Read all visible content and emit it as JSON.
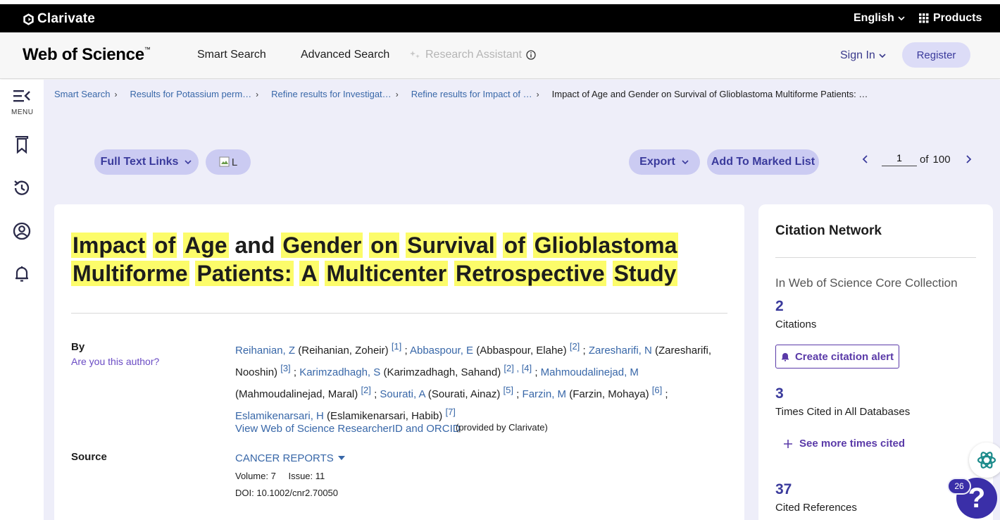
{
  "topbar": {
    "brand": "Clarivate",
    "language": "English",
    "products": "Products"
  },
  "header": {
    "logo": "Web of Science",
    "logo_tm": "™",
    "nav": [
      "Smart Search",
      "Advanced Search",
      "Research Assistant"
    ],
    "sign_in": "Sign In",
    "register": "Register"
  },
  "sidebar": {
    "menu_label": "MENU",
    "items": [
      "menu-icon",
      "marked-list-icon",
      "history-icon",
      "profile-icon",
      "alerts-icon"
    ]
  },
  "breadcrumb": [
    "Smart Search",
    "Results for Potassium perm…",
    "Refine results for Investigat…",
    "Refine results for Impact of …",
    "Impact of Age and Gender on Survival of Glioblastoma Multiforme Patients: …"
  ],
  "toolbar": {
    "full_text_links": "Full Text Links",
    "image_alt": "L",
    "export": "Export",
    "add_to_marked": "Add To Marked List",
    "page_current": "1",
    "page_of": "of",
    "page_total": "100"
  },
  "record": {
    "title_words": [
      "Impact",
      "of",
      "Age",
      "and",
      "Gender",
      "on",
      "Survival",
      "of",
      "Glioblastoma",
      "Multiforme",
      "Patients:",
      "A",
      "Multicenter",
      "Retrospective",
      "Study"
    ],
    "title_highlight": [
      true,
      true,
      true,
      false,
      true,
      true,
      true,
      true,
      true,
      true,
      true,
      true,
      true,
      true,
      true
    ],
    "by_label": "By",
    "are_you_author": "Are you this author?",
    "authors": [
      {
        "short": "Reihanian, Z",
        "full": "Reihanian, Zoheir",
        "refs": "[1]"
      },
      {
        "short": "Abbaspour, E",
        "full": "Abbaspour, Elahe",
        "refs": "[2]"
      },
      {
        "short": "Zaresharifi, N",
        "full": "Zaresharifi, Nooshin",
        "refs": "[3]"
      },
      {
        "short": "Karimzadhagh, S",
        "full": "Karimzadhagh, Sahand",
        "refs": "[2] , [4]"
      },
      {
        "short": "Mahmoudalinejad, M",
        "full": "Mahmoudalinejad, Maral",
        "refs": "[2]"
      },
      {
        "short": "Sourati, A",
        "full": "Sourati, Ainaz",
        "refs": "[5]"
      },
      {
        "short": "Farzin, M",
        "full": "Farzin, Mohaya",
        "refs": "[6]"
      },
      {
        "short": "Eslamikenarsari, H",
        "full": "Eslamikenarsari, Habib",
        "refs": "[7]"
      }
    ],
    "researcher_link": "View Web of Science ResearcherID and ORCID",
    "provided_by": "(provided by Clarivate)",
    "source_label": "Source",
    "source": "CANCER REPORTS",
    "volume_label": "Volume:",
    "volume": "7",
    "issue_label": "Issue:",
    "issue": "11",
    "doi_label": "DOI:",
    "doi": "10.1002/cnr2.70050"
  },
  "citation_network": {
    "title": "Citation Network",
    "collection": "In Web of Science Core Collection",
    "citations_count": "2",
    "citations_label": "Citations",
    "create_alert": "Create citation alert",
    "times_cited_count": "3",
    "times_cited_label": "Times Cited in All Databases",
    "see_more": "See more times cited",
    "cited_refs_count": "37",
    "cited_refs_label": "Cited References"
  },
  "floating": {
    "badge_count": "26",
    "help": "?"
  },
  "colors": {
    "highlight": "#fcfc6a",
    "link": "#3867a8",
    "accent": "#3a3a9c",
    "pill_bg": "#cbcbf2",
    "page_bg": "#eeeef9"
  }
}
